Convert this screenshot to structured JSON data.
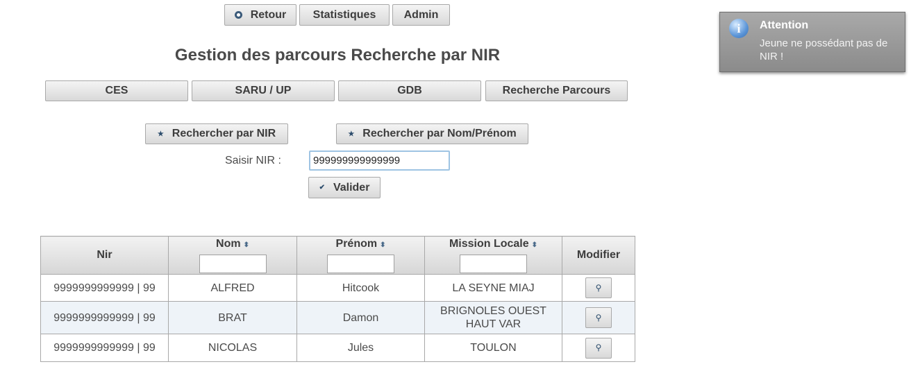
{
  "top_nav": {
    "back_label": "Retour",
    "stats_label": "Statistiques",
    "admin_label": "Admin"
  },
  "page_title": "Gestion des parcours Recherche par NIR",
  "sections": [
    "CES",
    "SARU / UP",
    "GDB",
    "Recherche Parcours"
  ],
  "search_modes": {
    "by_nir": "Rechercher par NIR",
    "by_name": "Rechercher par Nom/Prénom"
  },
  "nir_form": {
    "label": "Saisir NIR :",
    "value": "999999999999999",
    "submit_label": "Valider"
  },
  "table": {
    "headers": {
      "nir": "Nir",
      "nom": "Nom",
      "prenom": "Prénom",
      "mission": "Mission Locale",
      "modifier": "Modifier"
    },
    "rows": [
      {
        "nir": "9999999999999 | 99",
        "nom": "ALFRED",
        "prenom": "Hitcook",
        "mission": "LA SEYNE MIAJ"
      },
      {
        "nir": "9999999999999 | 99",
        "nom": "BRAT",
        "prenom": "Damon",
        "mission": "BRIGNOLES OUEST HAUT VAR"
      },
      {
        "nir": "9999999999999 | 99",
        "nom": "NICOLAS",
        "prenom": "Jules",
        "mission": "TOULON"
      }
    ]
  },
  "notification": {
    "title": "Attention",
    "message": "Jeune ne possédant pas de NIR !",
    "icon": "info-icon"
  }
}
